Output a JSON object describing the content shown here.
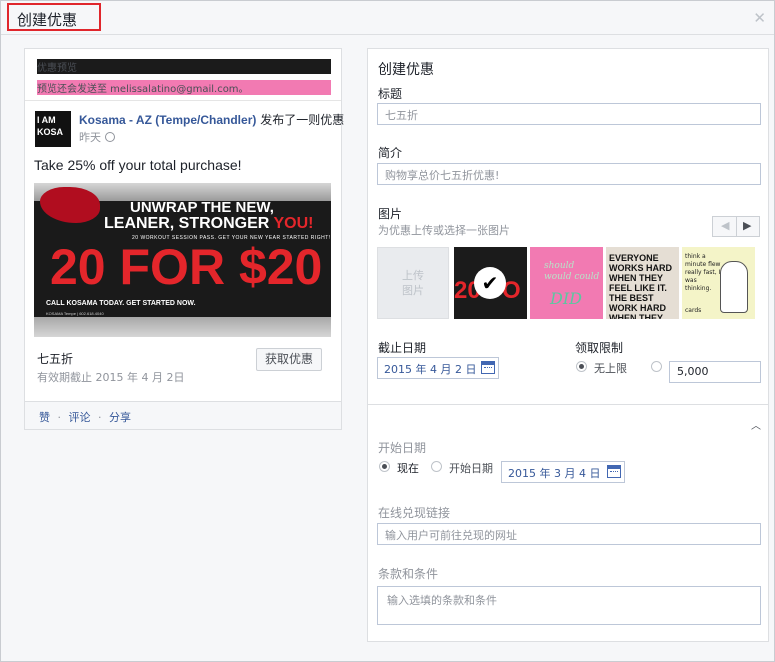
{
  "dialog": {
    "title": "创建优惠",
    "close_icon": "close-icon"
  },
  "preview": {
    "header_title": "优惠预览",
    "header_note": "预览还会发送至 melissalatino@gmail.com。",
    "avatar_text": "I AM KOSA",
    "page_name": "Kosama - AZ (Tempe/Chandler)",
    "action": "发布了一则优惠",
    "time": "昨天",
    "caption": "Take 25% off your total purchase!",
    "ad": {
      "headline1": "UNWRAP THE NEW,",
      "headline2a": "LEANER, STRONGER ",
      "headline2b": "YOU!",
      "subline": "20 WORKOUT SESSION PASS. GET YOUR NEW YEAR STARTED RIGHT!",
      "big": "20 FOR $20",
      "cta": "CALL KOSAMA TODAY. GET STARTED NOW.",
      "contact": "KOSAMA Tempe | 602.618.4040"
    },
    "offer_title": "七五折",
    "offer_expiry": "有效期截止 2015 年 4 月 2日",
    "get_button": "获取优惠",
    "social": {
      "like": "赞",
      "comment": "评论",
      "share": "分享",
      "dot": "·"
    }
  },
  "form": {
    "heading": "创建优惠",
    "title_label": "标题",
    "title_value": "七五折",
    "desc_label": "简介",
    "desc_value": "购物享总价七五折优惠!",
    "image_label": "图片",
    "image_hint": "为优惠上传或选择一张图片",
    "pager_prev": "◀",
    "pager_next": "▶",
    "upload_label1": "上传",
    "upload_label2": "图片",
    "thumbs": {
      "t1_text": "20 FO",
      "t2_text": "should would could",
      "t2_did": "DID",
      "t3_text": "EVERYONE WORKS HARD WHEN THEY FEEL LIKE IT. THE BEST WORK HARD WHEN THEY DON'T FEEL LIKE IT.",
      "t4_text": "think a minute flew really fast, I was thinking.",
      "t4_brand": "cards"
    },
    "end_date_label": "截止日期",
    "end_date_value": "2015 年 4 月 2 日",
    "limit_label": "领取限制",
    "limit_unlimited": "无上限",
    "limit_value": "5,000",
    "start_date_label": "开始日期",
    "start_now": "现在",
    "start_on": "开始日期",
    "start_date_value": "2015 年 3 月 4 日",
    "redeem_label": "在线兑现链接",
    "redeem_placeholder": "输入用户可前往兑现的网址",
    "terms_label": "条款和条件",
    "terms_placeholder": "输入选填的条款和条件",
    "collapse_icon": "chevron-up-icon"
  }
}
